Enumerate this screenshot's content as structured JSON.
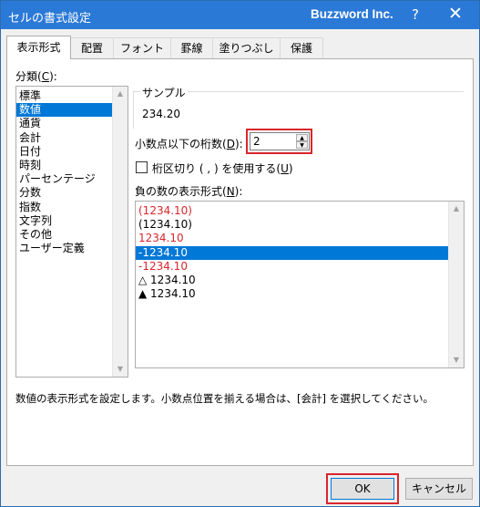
{
  "window": {
    "title": "セルの書式設定",
    "brand": "Buzzword Inc.",
    "help_label": "?",
    "close_label": "✕"
  },
  "tabs": [
    {
      "label": "表示形式",
      "active": true
    },
    {
      "label": "配置"
    },
    {
      "label": "フォント"
    },
    {
      "label": "罫線"
    },
    {
      "label": "塗りつぶし"
    },
    {
      "label": "保護"
    }
  ],
  "category": {
    "label": "分類(C):",
    "label_text": "分類(",
    "label_key": "C",
    "label_end": "):",
    "items": [
      "標準",
      "数値",
      "通貨",
      "会計",
      "日付",
      "時刻",
      "パーセンテージ",
      "分数",
      "指数",
      "文字列",
      "その他",
      "ユーザー定義"
    ],
    "selected_index": 1
  },
  "sample": {
    "label": "サンプル",
    "value": "234.20"
  },
  "decimal_places": {
    "label_text": "小数点以下の桁数(",
    "label_key": "D",
    "label_end": "):",
    "value": "2"
  },
  "thousands_separator": {
    "label_text": "桁区切り ( , ) を使用する(",
    "label_key": "U",
    "label_end": ")",
    "checked": false
  },
  "negative_numbers": {
    "label_text": "負の数の表示形式(",
    "label_key": "N",
    "label_end": "):",
    "items": [
      {
        "text": "(1234.10)",
        "color": "#d9262c"
      },
      {
        "text": "(1234.10)",
        "color": "#000000"
      },
      {
        "text": "1234.10",
        "color": "#d9262c"
      },
      {
        "text": "-1234.10",
        "color": "#000000"
      },
      {
        "text": "-1234.10",
        "color": "#d9262c"
      },
      {
        "text": "△ 1234.10",
        "color": "#000000"
      },
      {
        "text": "▲ 1234.10",
        "color": "#000000"
      }
    ],
    "selected_index": 3
  },
  "description": "数値の表示形式を設定します。小数点位置を揃える場合は、[会計] を選択してください。",
  "buttons": {
    "ok": "OK",
    "cancel": "キャンセル"
  },
  "colors": {
    "titlebar": "#2b79d7",
    "selection": "#0078d7",
    "highlight_box": "#d9262c"
  }
}
